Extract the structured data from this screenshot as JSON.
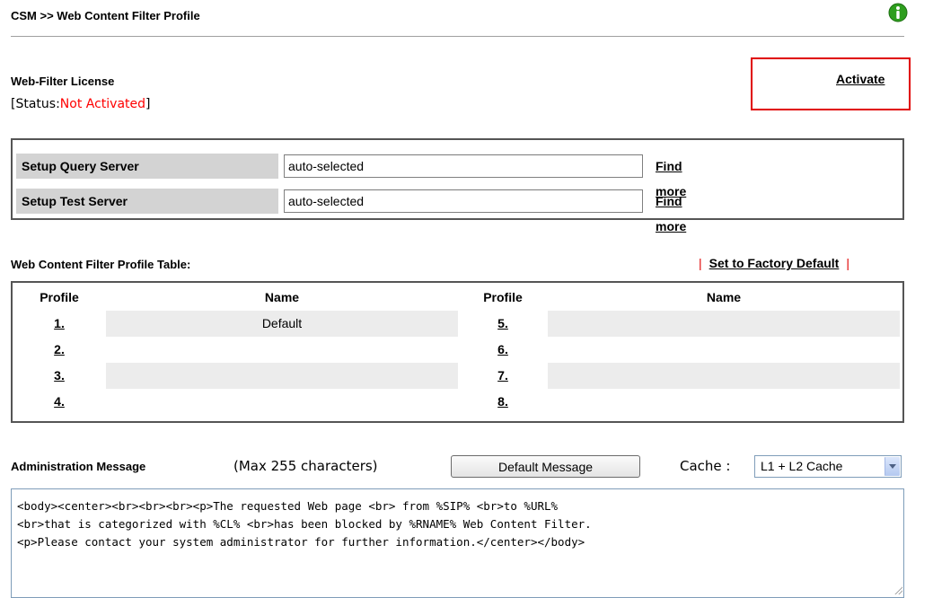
{
  "header": {
    "title": "CSM >> Web Content Filter Profile",
    "info_icon": "info-icon",
    "info_icon_color": "#2e9e1e"
  },
  "license": {
    "title": "Web-Filter License",
    "status_prefix": "[Status:",
    "status_value": "Not Activated",
    "status_suffix": "]",
    "status_color": "#ff0000",
    "activate_label": "Activate"
  },
  "servers": [
    {
      "label": "Setup Query Server",
      "value": "auto-selected",
      "link": "Find more"
    },
    {
      "label": "Setup Test Server",
      "value": "auto-selected",
      "link": "Find more"
    }
  ],
  "profile_table": {
    "caption": "Web Content Filter Profile Table:",
    "pipe": "|",
    "factory_default_label": "Set to Factory Default",
    "headers": {
      "profile_left": "Profile",
      "name_left": "Name",
      "profile_right": "Profile",
      "name_right": "Name"
    },
    "rows": [
      {
        "left_profile": "1.",
        "left_name": "Default",
        "right_profile": "5.",
        "right_name": ""
      },
      {
        "left_profile": "2.",
        "left_name": "",
        "right_profile": "6.",
        "right_name": ""
      },
      {
        "left_profile": "3.",
        "left_name": "",
        "right_profile": "7.",
        "right_name": ""
      },
      {
        "left_profile": "4.",
        "left_name": "",
        "right_profile": "8.",
        "right_name": ""
      }
    ]
  },
  "admin": {
    "label": "Administration Message",
    "max_chars": "(Max 255 characters)",
    "default_button": "Default Message",
    "cache_label": "Cache :",
    "cache_value": "L1 + L2 Cache",
    "message": "<body><center><br><br><br><p>The requested Web page <br> from %SIP% <br>to %URL%\n<br>that is categorized with %CL% <br>has been blocked by %RNAME% Web Content Filter.\n<p>Please contact your system administrator for further information.</center></body>"
  }
}
